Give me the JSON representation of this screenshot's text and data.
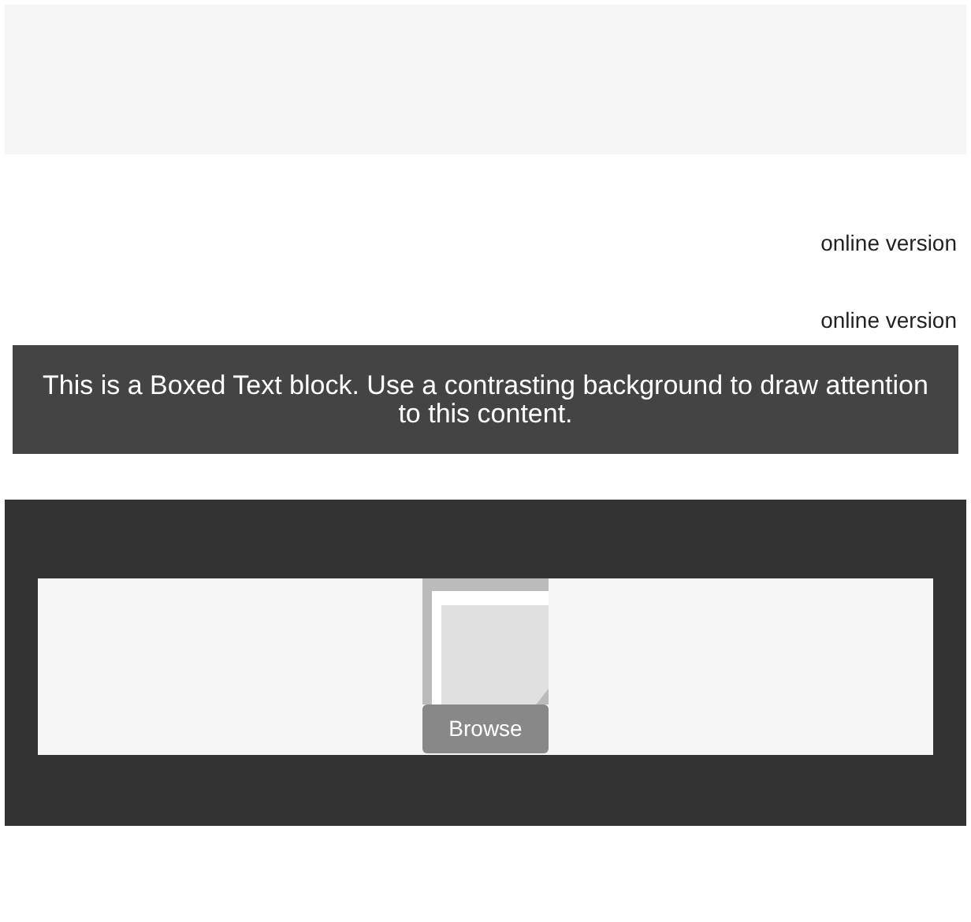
{
  "links": [
    "online version",
    "online version"
  ],
  "boxed_text": "This is a Boxed Text block. Use a contrasting background to draw attention to this content.",
  "image_block": {
    "button": "Browse"
  }
}
